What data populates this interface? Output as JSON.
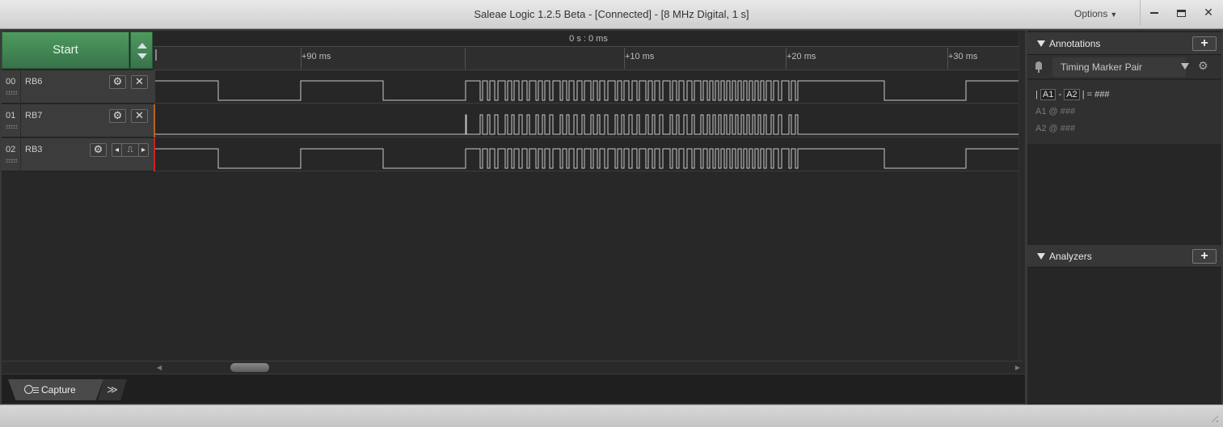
{
  "window": {
    "title": "Saleae Logic 1.2.5 Beta - [Connected] - [8 MHz Digital, 1 s]",
    "options_label": "Options",
    "close_glyph": "✕"
  },
  "controls": {
    "start_label": "Start"
  },
  "ruler": {
    "center_label": "0 s : 0 ms",
    "ticks": [
      "+90 ms",
      "+10 ms",
      "+20 ms",
      "+30 ms"
    ]
  },
  "channels": [
    {
      "num": "00",
      "name": "RB6",
      "color": "#3c3c3c"
    },
    {
      "num": "01",
      "name": "RB7",
      "color": "#b5651d"
    },
    {
      "num": "02",
      "name": "RB3",
      "color": "#cc2222"
    }
  ],
  "icons": {
    "gear": "⚙",
    "close": "✕",
    "trigger_left": "◂",
    "trigger_right": "▸",
    "trigger_pulse": "⎍"
  },
  "tabs": {
    "capture_label": "Capture",
    "more_label": "≫"
  },
  "annotations": {
    "title": "Annotations",
    "add_label": "+",
    "marker_label": "Timing Marker Pair",
    "expr_prefix": "|",
    "a1": "A1",
    "dash": "-",
    "a2": "A2",
    "expr_suffix": "| = ###",
    "a1_line": "A1  @  ###",
    "a2_line": "A2  @  ###"
  },
  "analyzers": {
    "title": "Analyzers",
    "add_label": "+"
  }
}
